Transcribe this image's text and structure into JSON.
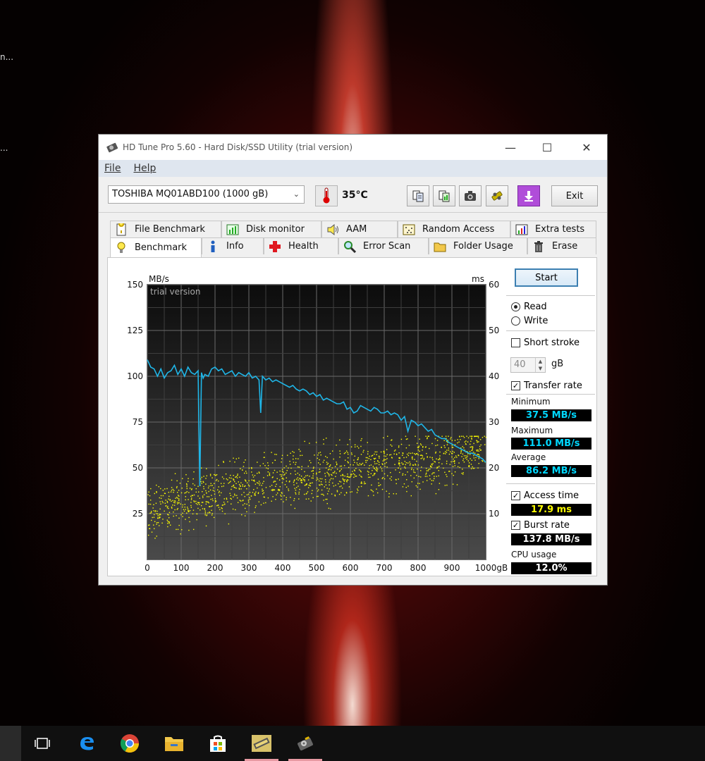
{
  "desktop": {
    "text_1": "n...",
    "text_2": "..."
  },
  "window": {
    "title": "HD Tune Pro 5.60 - Hard Disk/SSD Utility (trial version)",
    "controls": {
      "minimize": "—",
      "maximize": "☐",
      "close": "✕"
    }
  },
  "menu": {
    "file": "File",
    "help": "Help"
  },
  "toolbar": {
    "drive": "TOSHIBA MQ01ABD100 (1000 gB)",
    "temperature": "35°C",
    "exit_label": "Exit",
    "icons": [
      "copy-text-icon",
      "copy-info-icon",
      "camera-icon",
      "settings-icon",
      "download-icon"
    ]
  },
  "tabs_top": [
    {
      "label": "File Benchmark",
      "icon": "file-benchmark-icon"
    },
    {
      "label": "Disk monitor",
      "icon": "disk-monitor-icon"
    },
    {
      "label": "AAM",
      "icon": "speaker-icon"
    },
    {
      "label": "Random Access",
      "icon": "random-access-icon"
    },
    {
      "label": "Extra tests",
      "icon": "extra-tests-icon"
    }
  ],
  "tabs_bottom": [
    {
      "label": "Benchmark",
      "icon": "lightbulb-icon",
      "active": true
    },
    {
      "label": "Info",
      "icon": "info-icon"
    },
    {
      "label": "Health",
      "icon": "health-cross-icon"
    },
    {
      "label": "Error Scan",
      "icon": "magnifier-icon"
    },
    {
      "label": "Folder Usage",
      "icon": "folder-icon"
    },
    {
      "label": "Erase",
      "icon": "trash-icon"
    }
  ],
  "panel": {
    "start_label": "Start",
    "read_label": "Read",
    "write_label": "Write",
    "mode_selected": "Read",
    "short_stroke_label": "Short stroke",
    "short_stroke_checked": false,
    "short_stroke_value": "40",
    "short_stroke_unit": "gB",
    "transfer_rate_label": "Transfer rate",
    "transfer_rate_checked": true,
    "minimum_label": "Minimum",
    "minimum_value": "37.5 MB/s",
    "maximum_label": "Maximum",
    "maximum_value": "111.0 MB/s",
    "average_label": "Average",
    "average_value": "86.2 MB/s",
    "access_time_label": "Access time",
    "access_time_checked": true,
    "access_time_value": "17.9 ms",
    "burst_rate_label": "Burst rate",
    "burst_rate_checked": true,
    "burst_rate_value": "137.8 MB/s",
    "cpu_usage_label": "CPU usage",
    "cpu_usage_value": "12.0%",
    "transfer_color": "#00d8ff",
    "access_color": "#ffff00",
    "cpu_color": "#ffffff"
  },
  "chart_data": {
    "type": "line",
    "watermark": "trial version",
    "ylabel_left": "MB/s",
    "ylabel_right": "ms",
    "x_unit": "gB",
    "xlim": [
      0,
      1000
    ],
    "ylim_left": [
      0,
      150
    ],
    "ylim_right": [
      0,
      60
    ],
    "xticks": [
      "0",
      "100",
      "200",
      "300",
      "400",
      "500",
      "600",
      "700",
      "800",
      "900",
      "1000gB"
    ],
    "yticks_left": [
      "150",
      "125",
      "100",
      "75",
      "50",
      "25"
    ],
    "yticks_right": [
      "60",
      "50",
      "40",
      "30",
      "20",
      "10"
    ],
    "grid": true,
    "series": [
      {
        "name": "Transfer rate",
        "axis": "left",
        "color": "#1fb6e8",
        "x": [
          0,
          10,
          20,
          30,
          40,
          50,
          60,
          70,
          80,
          90,
          100,
          110,
          120,
          130,
          140,
          150,
          155,
          160,
          165,
          170,
          180,
          190,
          200,
          210,
          220,
          230,
          240,
          250,
          260,
          270,
          280,
          290,
          300,
          310,
          320,
          330,
          335,
          340,
          350,
          360,
          370,
          380,
          390,
          400,
          410,
          420,
          430,
          440,
          450,
          460,
          470,
          480,
          490,
          500,
          510,
          520,
          530,
          540,
          550,
          560,
          570,
          580,
          590,
          600,
          610,
          620,
          630,
          640,
          650,
          660,
          670,
          680,
          690,
          700,
          710,
          720,
          730,
          740,
          750,
          760,
          770,
          780,
          790,
          800,
          810,
          820,
          830,
          840,
          850,
          860,
          870,
          880,
          890,
          900,
          910,
          920,
          930,
          940,
          950,
          960,
          970,
          980,
          990,
          1000
        ],
        "values": [
          109,
          105,
          104,
          100,
          104,
          99,
          102,
          103,
          106,
          101,
          104,
          100,
          105,
          102,
          101,
          103,
          40,
          102,
          99,
          101,
          100,
          104,
          105,
          103,
          104,
          101,
          102,
          103,
          100,
          102,
          101,
          100,
          102,
          99,
          100,
          98,
          80,
          100,
          98,
          99,
          97,
          98,
          97,
          96,
          95,
          94,
          95,
          93,
          92,
          93,
          92,
          90,
          91,
          89,
          90,
          87,
          88,
          87,
          86,
          85,
          85,
          86,
          82,
          83,
          80,
          81,
          84,
          83,
          82,
          81,
          83,
          82,
          80,
          80,
          81,
          79,
          80,
          79,
          76,
          78,
          70,
          76,
          75,
          73,
          74,
          72,
          70,
          71,
          68,
          67,
          66,
          66,
          64,
          63,
          62,
          61,
          60,
          59,
          58,
          58,
          57,
          56,
          55,
          53
        ]
      }
    ],
    "access_time_scatter": {
      "name": "Access time",
      "axis": "right",
      "color": "#ffff00",
      "trend_ms_at_x": {
        "0": 10.5,
        "200": 14.5,
        "400": 17.5,
        "600": 19.5,
        "800": 21.5,
        "1000": 24.5
      },
      "spread_ms": [
        4,
        27
      ]
    }
  },
  "taskbar": {
    "items": [
      "task-view-icon",
      "edge-icon",
      "chrome-icon",
      "file-explorer-icon",
      "store-icon",
      "hd-tune-app-icon",
      "hd-tune-disk-icon"
    ]
  }
}
